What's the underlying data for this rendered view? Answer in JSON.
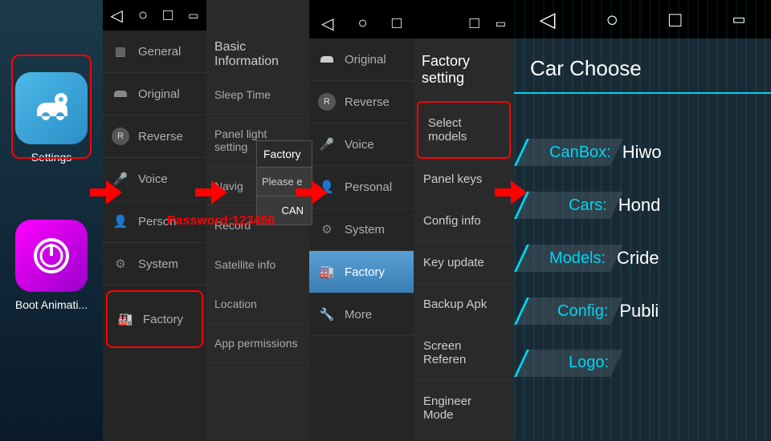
{
  "apps": {
    "settings": "Settings",
    "boot": "Boot Animati..."
  },
  "menu1": {
    "general": "General",
    "original": "Original",
    "reverse": "Reverse",
    "voice": "Voice",
    "personal": "Person",
    "system": "System",
    "factory": "Factory"
  },
  "info": {
    "title": "Basic Information",
    "sleep": "Sleep Time",
    "panel": "Panel light setting",
    "navi": "Navig",
    "record": "Record",
    "sat": "Satellite info",
    "loc": "Location",
    "perm": "App permissions"
  },
  "dialog": {
    "title": "Factory",
    "prompt": "Please e",
    "cancel": "CAN"
  },
  "password": "Password:123456",
  "menu2": {
    "original": "Original",
    "reverse": "Reverse",
    "voice": "Voice",
    "personal": "Personal",
    "system": "System",
    "factory": "Factory",
    "more": "More"
  },
  "factory": {
    "title": "Factory setting",
    "select": "Select models",
    "panel": "Panel keys",
    "config": "Config info",
    "key": "Key update",
    "backup": "Backup Apk",
    "screen": "Screen Referen",
    "engineer": "Engineer Mode"
  },
  "car": {
    "title": "Car Choose",
    "canbox_label": "CanBox:",
    "canbox_value": "Hiwo",
    "cars_label": "Cars:",
    "cars_value": "Hond",
    "models_label": "Models:",
    "models_value": "Cride",
    "config_label": "Config:",
    "config_value": "Publi",
    "logo_label": "Logo:"
  }
}
